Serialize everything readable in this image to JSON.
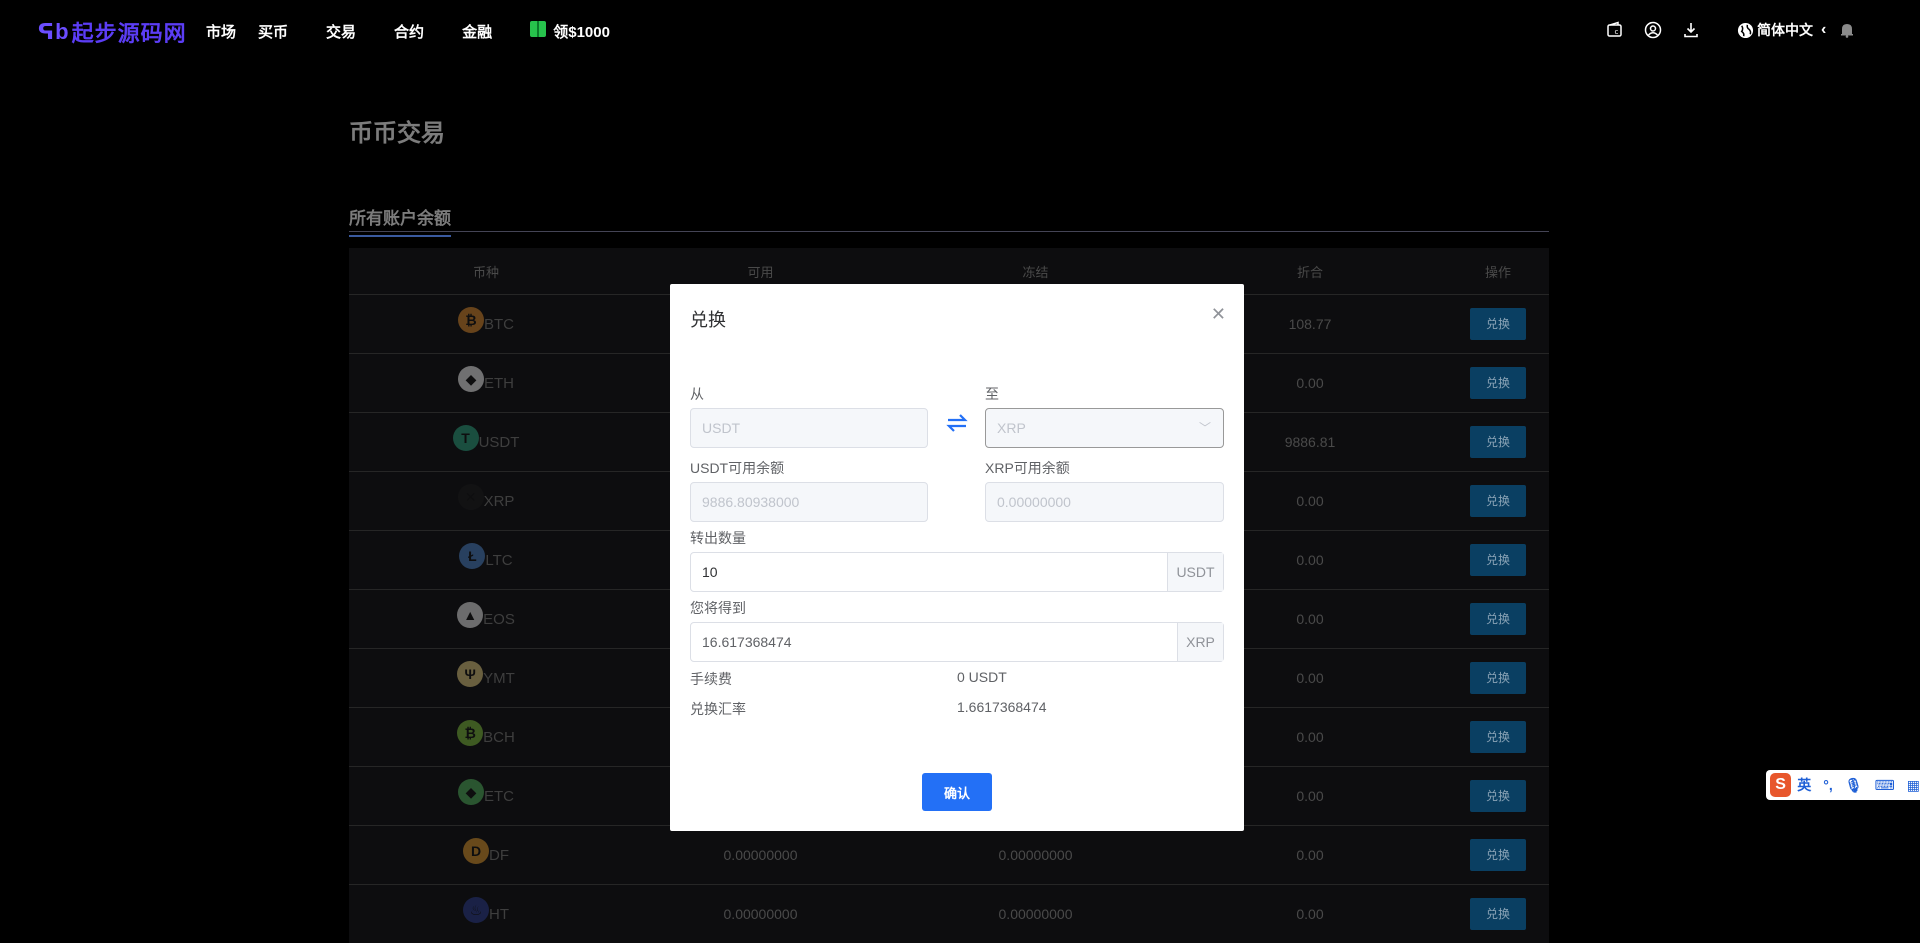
{
  "header": {
    "logo_mark": "ᕋb",
    "logo_text": "起步源码网",
    "nav": [
      "市场",
      "买币",
      "交易",
      "合约",
      "金融"
    ],
    "gift_label": "领$1000",
    "language": "简体中文",
    "icons": [
      "wallet-icon",
      "user-icon",
      "download-icon",
      "globe-icon",
      "bell-icon"
    ]
  },
  "page": {
    "title": "币币交易",
    "section_title": "所有账户余额"
  },
  "table": {
    "headers": [
      "币种",
      "可用",
      "冻结",
      "折合",
      "操作"
    ],
    "rows": [
      {
        "coin": "BTC",
        "available": "",
        "frozen": "",
        "equiv": "108.77",
        "action": "兑换",
        "color": "#d4862a",
        "glyph": "₿"
      },
      {
        "coin": "ETH",
        "available": "",
        "frozen": "",
        "equiv": "0.00",
        "action": "兑换",
        "color": "#e8e8e8",
        "glyph": "◆"
      },
      {
        "coin": "USDT",
        "available": "",
        "frozen": "",
        "equiv": "9886.81",
        "action": "兑换",
        "color": "#2a9d7a",
        "glyph": "T"
      },
      {
        "coin": "XRP",
        "available": "",
        "frozen": "",
        "equiv": "0.00",
        "action": "兑换",
        "color": "#1a1a1a",
        "glyph": "✕"
      },
      {
        "coin": "LTC",
        "available": "",
        "frozen": "",
        "equiv": "0.00",
        "action": "兑换",
        "color": "#4a7fc1",
        "glyph": "Ł"
      },
      {
        "coin": "EOS",
        "available": "",
        "frozen": "",
        "equiv": "0.00",
        "action": "兑换",
        "color": "#e0e0e0",
        "glyph": "▲"
      },
      {
        "coin": "YMT",
        "available": "",
        "frozen": "",
        "equiv": "0.00",
        "action": "兑换",
        "color": "#d9c27a",
        "glyph": "Ψ"
      },
      {
        "coin": "BCH",
        "available": "",
        "frozen": "",
        "equiv": "0.00",
        "action": "兑换",
        "color": "#7ab83a",
        "glyph": "₿"
      },
      {
        "coin": "ETC",
        "available": "",
        "frozen": "",
        "equiv": "0.00",
        "action": "兑换",
        "color": "#4fae5a",
        "glyph": "◆"
      },
      {
        "coin": "DF",
        "available": "0.00000000",
        "frozen": "0.00000000",
        "equiv": "0.00",
        "action": "兑换",
        "color": "#d6922a",
        "glyph": "D"
      },
      {
        "coin": "HT",
        "available": "0.00000000",
        "frozen": "0.00000000",
        "equiv": "0.00",
        "action": "兑换",
        "color": "#2a3b8a",
        "glyph": "♨"
      }
    ]
  },
  "modal": {
    "title": "兑换",
    "from_label": "从",
    "from_value": "USDT",
    "to_label": "至",
    "to_value": "XRP",
    "from_balance_label": "USDT可用余额",
    "from_balance_value": "9886.80938000",
    "to_balance_label": "XRP可用余额",
    "to_balance_value": "0.00000000",
    "amount_label": "转出数量",
    "amount_value": "10",
    "amount_unit": "USDT",
    "receive_label": "您将得到",
    "receive_value": "16.617368474",
    "receive_unit": "XRP",
    "fee_label": "手续费",
    "fee_value": "0 USDT",
    "rate_label": "兑换汇率",
    "rate_value": "1.6617368474",
    "confirm_label": "确认"
  },
  "ime": {
    "logo": "S",
    "mode": "英",
    "punct": "°,"
  }
}
